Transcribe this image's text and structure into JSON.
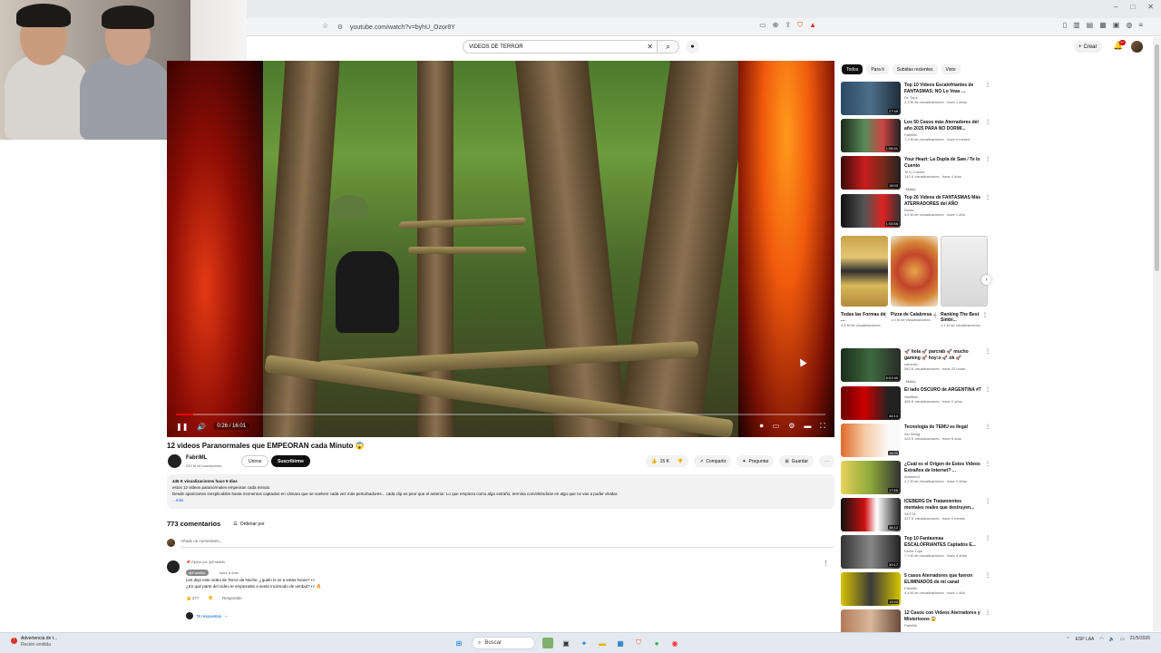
{
  "browser": {
    "url": "youtube.com/watch?v=byhU_Ozor8Y",
    "window_controls": [
      "–",
      "□",
      "✕"
    ]
  },
  "header": {
    "search_value": "VIDEOS DE TERROR",
    "create_label": "Crear",
    "notif_count": "9+"
  },
  "player": {
    "time": "0:26 / 16:01",
    "progress": 0.027
  },
  "video": {
    "title": "12 videos Paranormales que EMPEORAN cada Minuto 😱",
    "channel": "FabriML",
    "subs": "220 M de suscriptores",
    "join_label": "Unirse",
    "subscribe_label": "Suscribirme",
    "likes": "15 K",
    "share_label": "Compartir",
    "ask_label": "Preguntar",
    "save_label": "Guardar",
    "desc_meta": "445 K visualizaciones  hace 9 días",
    "desc_line1": "estos 12 videos paranormales empeoran cada minuto",
    "desc_line2": "Desde apariciones inexplicables hasta momentos captados en cámara que se vuelven cada vez más perturbadores... cada clip es peor que el anterior. Lo que empieza como algo extraño, termina convirtiéndose en algo que no vas a poder olvidar.",
    "desc_more": "...más"
  },
  "comments": {
    "count": "773 comentarios",
    "sort_label": "Ordenar por",
    "add_placeholder": "Añade un comentario...",
    "pinned_label": "Fijado por @FabriML",
    "pinned_author": "@FabriML",
    "pinned_time": "hace 8 días",
    "pinned_line1": "Les dejo este video de Terror de Noche, ¿quién lo ve a estas horas? 👀",
    "pinned_line2": "¿En qué parte del video te empezaste a sentir incómodo de verdad? 👀🔥",
    "pinned_likes": "277",
    "reply_label": "Responder",
    "replies_label": "78 respuestas"
  },
  "sidebar": {
    "chips": [
      "Todos",
      "Para ti",
      "Subidas recientes",
      "Visto"
    ],
    "recommendations": [
      {
        "title": "Top 10 Videos Escalofriantes de FANTASMAS: NO Lo Veas ...",
        "channel": "Dr. Tops",
        "views": "2,3 M de visualizaciones · hace 1 años",
        "duration": "27:49",
        "badge": ""
      },
      {
        "title": "Los 50 Casos más Aterradores del año 2025 PARA NO DORMI...",
        "channel": "FabriML",
        "views": "7,3 M de visualizaciones · hace 4 meses",
        "duration": "1:08:41",
        "badge": ""
      },
      {
        "title": "Your Heart: La Dupla de Saw / Te lo Cuento",
        "channel": "Te lo Cuento",
        "views": "140 K visualizaciones · hace 4 días",
        "duration": "18:03",
        "badge": "Nuevo"
      },
      {
        "title": "Top 26 Videos de FANTASMAS Más ATERRADORES del AÑO",
        "channel": "Dross",
        "views": "4,6 M de visualizaciones · hace 1 año",
        "duration": "1:03:55",
        "badge": ""
      },
      {
        "title": "🚀 hola 🚀 parcrab 🚀 mucho gaming 🚀 hoy:o 🚀 ok 🚀",
        "channel": "carreola",
        "views": "552 K visualizaciones · hace 20 horas",
        "duration": "6:01:40",
        "badge": "Nuevo"
      },
      {
        "title": "El lado OSCURO de ARGENTINA #7",
        "channel": "Wallflow",
        "views": "465 K visualizaciones · hace 2 años",
        "duration": "46:13",
        "badge": ""
      },
      {
        "title": "Tecnología de TEMU es Ilegal",
        "channel": "Alo Wang",
        "views": "424 K visualizaciones · hace 6 días",
        "duration": "18:20",
        "badge": ""
      },
      {
        "title": "¿Cuál es el Origen de Estos Videos Extraños de Internet? ...",
        "channel": "dubemod",
        "views": "4,2 M de visualizaciones · hace 2 años",
        "duration": "17:58",
        "badge": ""
      },
      {
        "title": "ICEBERG De Tratamientos mentales reales que destruyen...",
        "channel": "SKTTA",
        "views": "317 K visualizaciones · hace 2 meses",
        "duration": "38:12",
        "badge": ""
      },
      {
        "title": "Top 10 Fantasmas ESCALOFRIANTES Captados E...",
        "channel": "Dross Tops",
        "views": "7,9 M de visualizaciones · hace 3 años",
        "duration": "30:17",
        "badge": ""
      },
      {
        "title": "5 casos Aterradores que fueron ELIMINADOS de mi canal",
        "channel": "FabriML",
        "views": "4,4 M de visualizaciones · hace 1 año",
        "duration": "13:22",
        "badge": ""
      },
      {
        "title": "12 Casos con Videos Aterradores y Misteriosos 😱",
        "channel": "FabriML",
        "views": "",
        "duration": "",
        "badge": ""
      }
    ],
    "shorts": [
      {
        "title": "Todas las Formas de ...",
        "views": "2,9 M de visualizaciones"
      },
      {
        "title": "Pizza de Calabresa ...",
        "views": "1,5 M de visualizaciones"
      },
      {
        "title": "Ranking The Best Simbi...",
        "views": "1,1 M de visualizaciones"
      }
    ]
  },
  "taskbar": {
    "warn_title": "Advertencia de t...",
    "warn_sub": "Recién emitida",
    "search_label": "Buscar",
    "lang": "ESP LAA",
    "time": "",
    "date": "21/5/2026"
  },
  "colors": {
    "accent_red": "#ff0000",
    "subscribe_bg": "#0f0f0f",
    "link_blue": "#065fd4"
  }
}
